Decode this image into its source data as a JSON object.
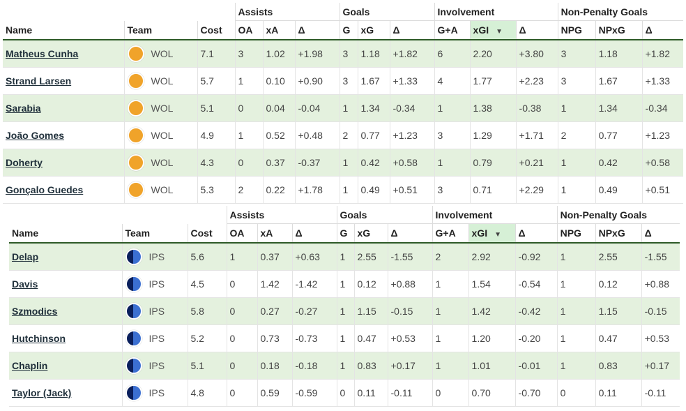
{
  "groups": [
    "Assists",
    "Goals",
    "Involvement",
    "Non-Penalty Goals"
  ],
  "columns": [
    "Name",
    "Team",
    "Cost",
    "OA",
    "xA",
    "Δ",
    "G",
    "xG",
    "Δ",
    "G+A",
    "xGI",
    "Δ",
    "NPG",
    "NPxG",
    "Δ"
  ],
  "sorted_column": "xGI",
  "sort_indicator": "▼",
  "colors": {
    "accent": "#2d5a27",
    "row_highlight": "#e4f1de",
    "wol": "#f0a32a",
    "ips": "#1d3a8a"
  },
  "tables": [
    {
      "team_icon": "wolves-badge-icon",
      "rows": [
        {
          "name": "Matheus Cunha",
          "team": "WOL",
          "cost": "7.1",
          "oa": "3",
          "xa": "1.02",
          "da": "+1.98",
          "g": "3",
          "xg": "1.18",
          "dg": "+1.82",
          "ga": "6",
          "xgi": "2.20",
          "dgi": "+3.80",
          "npg": "3",
          "npxg": "1.18",
          "dnp": "+1.82"
        },
        {
          "name": "Strand Larsen",
          "team": "WOL",
          "cost": "5.7",
          "oa": "1",
          "xa": "0.10",
          "da": "+0.90",
          "g": "3",
          "xg": "1.67",
          "dg": "+1.33",
          "ga": "4",
          "xgi": "1.77",
          "dgi": "+2.23",
          "npg": "3",
          "npxg": "1.67",
          "dnp": "+1.33"
        },
        {
          "name": "Sarabia",
          "team": "WOL",
          "cost": "5.1",
          "oa": "0",
          "xa": "0.04",
          "da": "-0.04",
          "g": "1",
          "xg": "1.34",
          "dg": "-0.34",
          "ga": "1",
          "xgi": "1.38",
          "dgi": "-0.38",
          "npg": "1",
          "npxg": "1.34",
          "dnp": "-0.34"
        },
        {
          "name": "João Gomes",
          "team": "WOL",
          "cost": "4.9",
          "oa": "1",
          "xa": "0.52",
          "da": "+0.48",
          "g": "2",
          "xg": "0.77",
          "dg": "+1.23",
          "ga": "3",
          "xgi": "1.29",
          "dgi": "+1.71",
          "npg": "2",
          "npxg": "0.77",
          "dnp": "+1.23"
        },
        {
          "name": "Doherty",
          "team": "WOL",
          "cost": "4.3",
          "oa": "0",
          "xa": "0.37",
          "da": "-0.37",
          "g": "1",
          "xg": "0.42",
          "dg": "+0.58",
          "ga": "1",
          "xgi": "0.79",
          "dgi": "+0.21",
          "npg": "1",
          "npxg": "0.42",
          "dnp": "+0.58"
        },
        {
          "name": "Gonçalo Guedes",
          "team": "WOL",
          "cost": "5.3",
          "oa": "2",
          "xa": "0.22",
          "da": "+1.78",
          "g": "1",
          "xg": "0.49",
          "dg": "+0.51",
          "ga": "3",
          "xgi": "0.71",
          "dgi": "+2.29",
          "npg": "1",
          "npxg": "0.49",
          "dnp": "+0.51"
        }
      ]
    },
    {
      "team_icon": "ipswich-badge-icon",
      "rows": [
        {
          "name": "Delap",
          "team": "IPS",
          "cost": "5.6",
          "oa": "1",
          "xa": "0.37",
          "da": "+0.63",
          "g": "1",
          "xg": "2.55",
          "dg": "-1.55",
          "ga": "2",
          "xgi": "2.92",
          "dgi": "-0.92",
          "npg": "1",
          "npxg": "2.55",
          "dnp": "-1.55"
        },
        {
          "name": "Davis",
          "team": "IPS",
          "cost": "4.5",
          "oa": "0",
          "xa": "1.42",
          "da": "-1.42",
          "g": "1",
          "xg": "0.12",
          "dg": "+0.88",
          "ga": "1",
          "xgi": "1.54",
          "dgi": "-0.54",
          "npg": "1",
          "npxg": "0.12",
          "dnp": "+0.88"
        },
        {
          "name": "Szmodics",
          "team": "IPS",
          "cost": "5.8",
          "oa": "0",
          "xa": "0.27",
          "da": "-0.27",
          "g": "1",
          "xg": "1.15",
          "dg": "-0.15",
          "ga": "1",
          "xgi": "1.42",
          "dgi": "-0.42",
          "npg": "1",
          "npxg": "1.15",
          "dnp": "-0.15"
        },
        {
          "name": "Hutchinson",
          "team": "IPS",
          "cost": "5.2",
          "oa": "0",
          "xa": "0.73",
          "da": "-0.73",
          "g": "1",
          "xg": "0.47",
          "dg": "+0.53",
          "ga": "1",
          "xgi": "1.20",
          "dgi": "-0.20",
          "npg": "1",
          "npxg": "0.47",
          "dnp": "+0.53"
        },
        {
          "name": "Chaplin",
          "team": "IPS",
          "cost": "5.1",
          "oa": "0",
          "xa": "0.18",
          "da": "-0.18",
          "g": "1",
          "xg": "0.83",
          "dg": "+0.17",
          "ga": "1",
          "xgi": "1.01",
          "dgi": "-0.01",
          "npg": "1",
          "npxg": "0.83",
          "dnp": "+0.17"
        },
        {
          "name": "Taylor (Jack)",
          "team": "IPS",
          "cost": "4.8",
          "oa": "0",
          "xa": "0.59",
          "da": "-0.59",
          "g": "0",
          "xg": "0.11",
          "dg": "-0.11",
          "ga": "0",
          "xgi": "0.70",
          "dgi": "-0.70",
          "npg": "0",
          "npxg": "0.11",
          "dnp": "-0.11"
        }
      ]
    }
  ]
}
